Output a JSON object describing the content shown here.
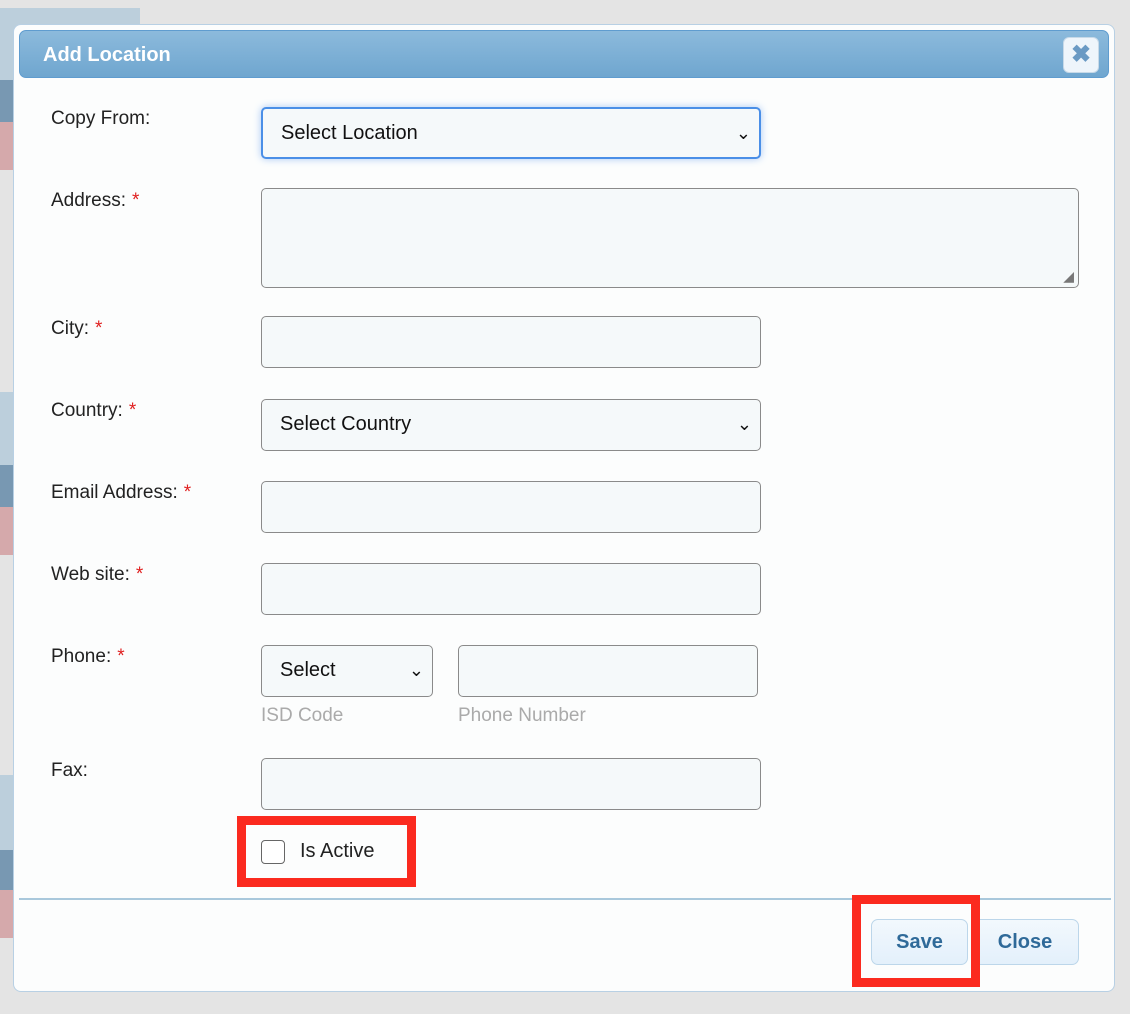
{
  "dialog": {
    "title": "Add Location",
    "close_icon": "close-x-icon"
  },
  "form": {
    "copy_from": {
      "label": "Copy From:",
      "value": "Select Location"
    },
    "address": {
      "label": "Address:",
      "required": "*",
      "value": ""
    },
    "city": {
      "label": "City:",
      "required": "*",
      "value": ""
    },
    "country": {
      "label": "Country:",
      "required": "*",
      "value": "Select Country"
    },
    "email": {
      "label": "Email Address:",
      "required": "*",
      "value": ""
    },
    "website": {
      "label": "Web site:",
      "required": "*",
      "value": ""
    },
    "phone": {
      "label": "Phone:",
      "required": "*",
      "isd_value": "Select",
      "isd_help": "ISD Code",
      "number_value": "",
      "number_help": "Phone Number"
    },
    "fax": {
      "label": "Fax:",
      "value": ""
    },
    "is_active": {
      "label": "Is Active",
      "checked": false
    }
  },
  "footer": {
    "save_label": "Save",
    "close_label": "Close"
  },
  "colors": {
    "title_bar": "#7aaed5",
    "highlight": "#fb2a1f",
    "button_text": "#2f6a99"
  }
}
